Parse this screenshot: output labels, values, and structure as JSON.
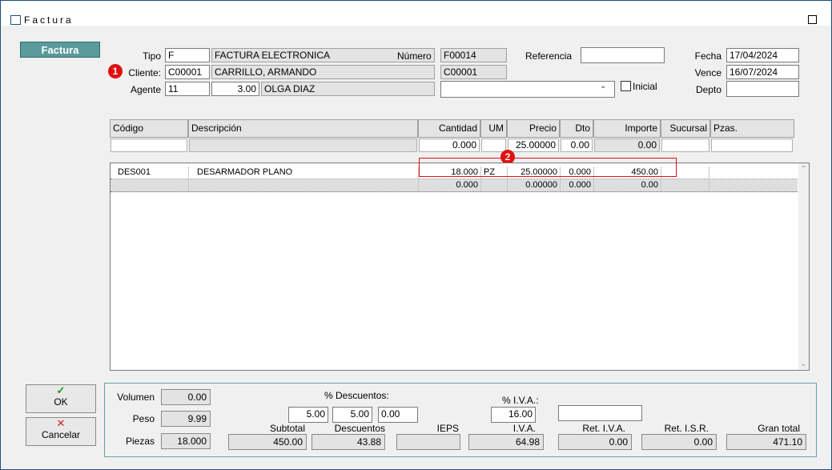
{
  "window": {
    "title": "Factura"
  },
  "tab_button": "Factura",
  "markers": [
    "1",
    "2"
  ],
  "header": {
    "tipo_label": "Tipo",
    "tipo_code": "F",
    "tipo_desc": "FACTURA ELECTRONICA",
    "numero_label": "Número",
    "numero": "F00014",
    "numero_sub": "C00001",
    "referencia_label": "Referencia",
    "referencia": "",
    "fecha_label": "Fecha",
    "fecha": "17/04/2024",
    "vence_label": "Vence",
    "vence": "16/07/2024",
    "depto_label": "Depto",
    "depto": "",
    "cliente_label": "Cliente:",
    "cliente_code": "C00001",
    "cliente_name": "CARRILLO, ARMANDO",
    "agente_label": "Agente",
    "agente_code": "11",
    "agente_pct": "3.00",
    "agente_name": "OLGA DIAZ",
    "combo_value": "",
    "inicial_label": "Inicial"
  },
  "columns": [
    "Código",
    "Descripción",
    "Cantidad",
    "UM",
    "Precio",
    "Dto",
    "Importe",
    "Sucursal",
    "Pzas."
  ],
  "entry_row": {
    "codigo": "",
    "descripcion": "",
    "cantidad": "0.000",
    "um": "",
    "precio": "25.00000",
    "dto": "0.00",
    "importe": "0.00",
    "sucursal": "",
    "pzas": ""
  },
  "rows": [
    {
      "codigo": "DES001",
      "descripcion": "DESARMADOR PLANO",
      "cantidad": "18.000",
      "um": "PZ",
      "precio": "25.00000",
      "dto": "0.000",
      "importe": "450.00",
      "sucursal": "",
      "pzas": ""
    },
    {
      "codigo": "",
      "descripcion": "",
      "cantidad": "0.000",
      "um": "",
      "precio": "0.00000",
      "dto": "0.000",
      "importe": "0.00",
      "sucursal": "",
      "pzas": ""
    }
  ],
  "buttons": {
    "ok": "OK",
    "cancel": "Cancelar"
  },
  "totals": {
    "volumen_label": "Volumen",
    "volumen": "0.00",
    "peso_label": "Peso",
    "peso": "9.99",
    "piezas_label": "Piezas",
    "piezas": "18.000",
    "descuentos_pct_label": "% Descuentos:",
    "desc1": "5.00",
    "desc2": "5.00",
    "desc3": "0.00",
    "iva_pct_label": "% I.V.A.:",
    "iva_pct": "16.00",
    "extra_field": "",
    "subtotal_label": "Subtotal",
    "subtotal": "450.00",
    "descuentos_label": "Descuentos",
    "descuentos": "43.88",
    "ieps_label": "IEPS",
    "ieps": "",
    "iva_label": "I.V.A.",
    "iva": "64.98",
    "ret_iva_label": "Ret. I.V.A.",
    "ret_iva": "0.00",
    "ret_isr_label": "Ret. I.S.R.",
    "ret_isr": "0.00",
    "gran_total_label": "Gran total",
    "gran_total": "471.10"
  },
  "colors": {
    "accent": "#5b9a9a",
    "marker": "#e01010",
    "highlight": "#e01010"
  }
}
